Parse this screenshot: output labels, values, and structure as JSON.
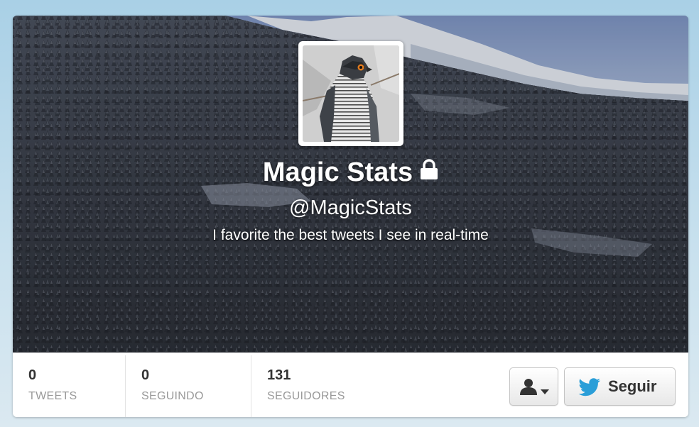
{
  "profile": {
    "name": "Magic Stats",
    "handle": "@MagicStats",
    "bio": "I favorite the best tweets I see in real-time",
    "protected_icon": "lock-icon",
    "avatar_icon": "hawk-avatar"
  },
  "stats": [
    {
      "value": "0",
      "label": "TWEETS"
    },
    {
      "value": "0",
      "label": "SEGUINDO"
    },
    {
      "value": "131",
      "label": "SEGUIDORES"
    }
  ],
  "actions": {
    "user_menu_icon": "user-icon",
    "follow_icon": "twitter-bird-icon",
    "follow_label": "Seguir"
  },
  "colors": {
    "stat_value": "#333333",
    "stat_label": "#999999",
    "follow_bird": "#2a9ed8"
  }
}
